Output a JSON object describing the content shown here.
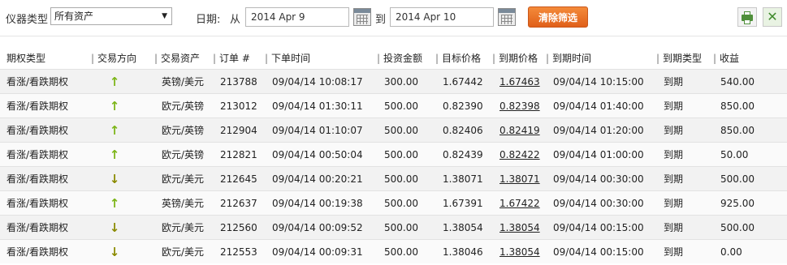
{
  "filters": {
    "instrument_label": "仪器类型",
    "instrument_value": "所有资产",
    "date_label": "日期:",
    "from_label": "从",
    "from_date": "2014 Apr 9",
    "to_label": "到",
    "to_date": "2014 Apr 10",
    "clear_label": "清除筛选"
  },
  "columns": [
    "期权类型",
    "交易方向",
    "交易资产",
    "订单 #",
    "下单时间",
    "投资金额",
    "目标价格",
    "到期价格",
    "到期时间",
    "到期类型",
    "收益"
  ],
  "rows": [
    {
      "type": "看涨/看跌期权",
      "dir": "up",
      "asset": "英镑/美元",
      "order": "213788",
      "time": "09/04/14 10:08:17",
      "amount": "300.00",
      "target": "1.67442",
      "expiry_price": "1.67463",
      "expiry_time": "09/04/14 10:15:00",
      "expiry_type": "到期",
      "profit": "540.00"
    },
    {
      "type": "看涨/看跌期权",
      "dir": "up",
      "asset": "欧元/英镑",
      "order": "213012",
      "time": "09/04/14 01:30:11",
      "amount": "500.00",
      "target": "0.82390",
      "expiry_price": "0.82398",
      "expiry_time": "09/04/14 01:40:00",
      "expiry_type": "到期",
      "profit": "850.00"
    },
    {
      "type": "看涨/看跌期权",
      "dir": "up",
      "asset": "欧元/英镑",
      "order": "212904",
      "time": "09/04/14 01:10:07",
      "amount": "500.00",
      "target": "0.82406",
      "expiry_price": "0.82419",
      "expiry_time": "09/04/14 01:20:00",
      "expiry_type": "到期",
      "profit": "850.00"
    },
    {
      "type": "看涨/看跌期权",
      "dir": "up",
      "asset": "欧元/英镑",
      "order": "212821",
      "time": "09/04/14 00:50:04",
      "amount": "500.00",
      "target": "0.82439",
      "expiry_price": "0.82422",
      "expiry_time": "09/04/14 01:00:00",
      "expiry_type": "到期",
      "profit": "50.00"
    },
    {
      "type": "看涨/看跌期权",
      "dir": "down",
      "asset": "欧元/美元",
      "order": "212645",
      "time": "09/04/14 00:20:21",
      "amount": "500.00",
      "target": "1.38071",
      "expiry_price": "1.38071",
      "expiry_time": "09/04/14 00:30:00",
      "expiry_type": "到期",
      "profit": "500.00"
    },
    {
      "type": "看涨/看跌期权",
      "dir": "up",
      "asset": "英镑/美元",
      "order": "212637",
      "time": "09/04/14 00:19:38",
      "amount": "500.00",
      "target": "1.67391",
      "expiry_price": "1.67422",
      "expiry_time": "09/04/14 00:30:00",
      "expiry_type": "到期",
      "profit": "925.00"
    },
    {
      "type": "看涨/看跌期权",
      "dir": "down",
      "asset": "欧元/美元",
      "order": "212560",
      "time": "09/04/14 00:09:52",
      "amount": "500.00",
      "target": "1.38054",
      "expiry_price": "1.38054",
      "expiry_time": "09/04/14 00:15:00",
      "expiry_type": "到期",
      "profit": "500.00"
    },
    {
      "type": "看涨/看跌期权",
      "dir": "down",
      "asset": "欧元/美元",
      "order": "212553",
      "time": "09/04/14 00:09:31",
      "amount": "500.00",
      "target": "1.38046",
      "expiry_price": "1.38054",
      "expiry_time": "09/04/14 00:15:00",
      "expiry_type": "到期",
      "profit": "0.00"
    }
  ],
  "icons": {
    "print": "printer-icon",
    "excel": "excel-icon",
    "calendar": "calendar-icon",
    "arrow_up": "arrow-up-icon",
    "arrow_down": "arrow-down-icon"
  },
  "colors": {
    "clear_button": "#e86c22",
    "arrow_up": "#7cb518",
    "arrow_down": "#8a8a00"
  }
}
